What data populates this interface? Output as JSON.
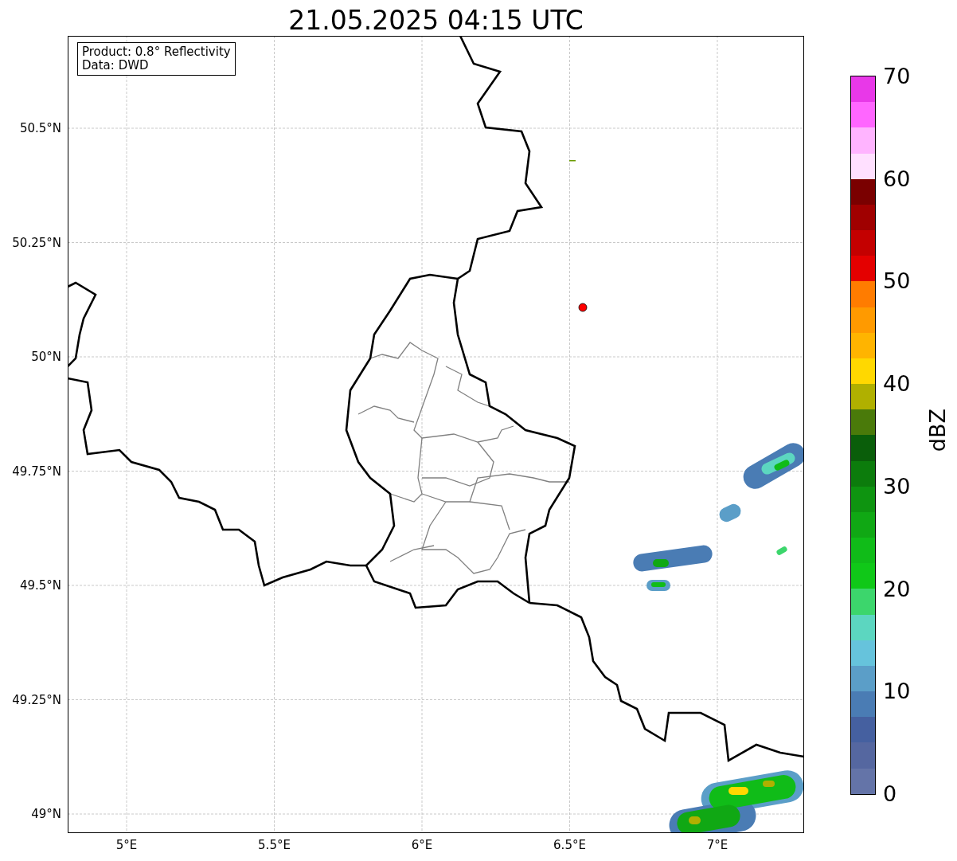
{
  "title": "21.05.2025 04:15 UTC",
  "annotation": {
    "lines": [
      "Product: 0.8° Reflectivity",
      "Data: DWD"
    ]
  },
  "map": {
    "x_tick_labels": [
      "5°E",
      "5.5°E",
      "6°E",
      "6.5°E",
      "7°E"
    ],
    "y_tick_labels": [
      "50.5°N",
      "50.25°N",
      "50°N",
      "49.75°N",
      "49.5°N",
      "49.25°N",
      "49°N"
    ]
  },
  "colorbar": {
    "label": "dBZ",
    "tick_labels": [
      "70",
      "60",
      "50",
      "40",
      "30",
      "20",
      "10",
      "0"
    ],
    "segments": [
      {
        "color": "#6474a8"
      },
      {
        "color": "#5567a0"
      },
      {
        "color": "#4560a0"
      },
      {
        "color": "#4a7cb4"
      },
      {
        "color": "#5b9ec8"
      },
      {
        "color": "#66c3dc"
      },
      {
        "color": "#5cd6c0"
      },
      {
        "color": "#3cd66c"
      },
      {
        "color": "#10c818"
      },
      {
        "color": "#10bc18"
      },
      {
        "color": "#10a814"
      },
      {
        "color": "#0e9410"
      },
      {
        "color": "#0c7c0c"
      },
      {
        "color": "#0a5e0a"
      },
      {
        "color": "#4a7a0a"
      },
      {
        "color": "#b0b000"
      },
      {
        "color": "#ffd800"
      },
      {
        "color": "#ffb400"
      },
      {
        "color": "#ff9a00"
      },
      {
        "color": "#ff7c00"
      },
      {
        "color": "#e40000"
      },
      {
        "color": "#c40000"
      },
      {
        "color": "#a00000"
      },
      {
        "color": "#7a0000"
      },
      {
        "color": "#ffe0ff"
      },
      {
        "color": "#ffb4ff"
      },
      {
        "color": "#ff66ff"
      },
      {
        "color": "#e838e8"
      }
    ]
  }
}
